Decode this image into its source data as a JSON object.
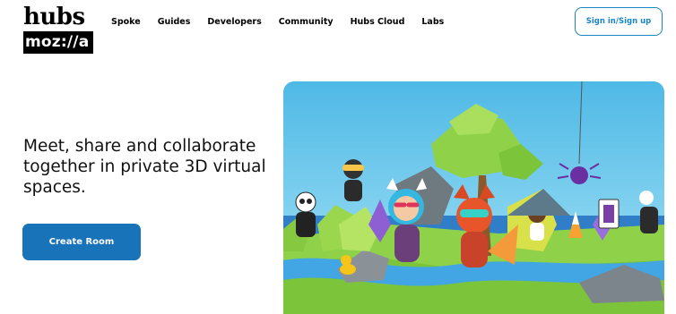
{
  "logo": {
    "top": "hubs",
    "bottom": "moz://a"
  },
  "nav": {
    "items": [
      {
        "label": "Spoke"
      },
      {
        "label": "Guides"
      },
      {
        "label": "Developers"
      },
      {
        "label": "Community"
      },
      {
        "label": "Hubs Cloud"
      },
      {
        "label": "Labs"
      }
    ]
  },
  "header": {
    "signin_label": "Sign in/Sign up"
  },
  "hero": {
    "headline": "Meet, share and collaborate together in private 3D virtual spaces.",
    "cta_label": "Create Room",
    "colors": {
      "accent": "#1873b8",
      "sky": "#5ec5ec",
      "grass": "#8fd24a"
    }
  }
}
